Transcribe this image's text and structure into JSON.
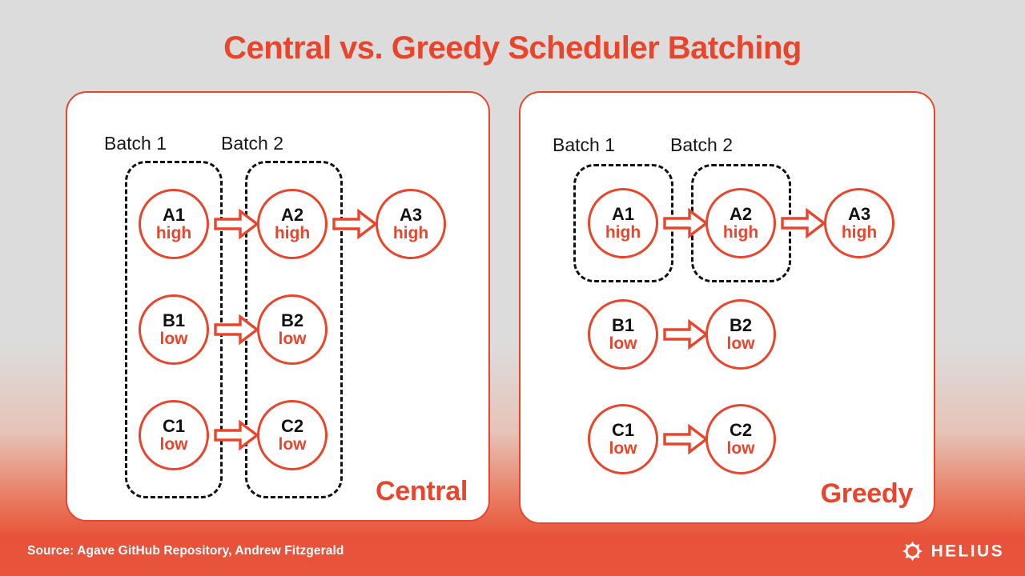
{
  "title": "Central vs. Greedy Scheduler Batching",
  "theme": {
    "accent": "#e8452c",
    "node_border": "#e8452c",
    "node_id_color": "#111214",
    "priority_color": "#e8452c",
    "batch_box_color": "#111111",
    "background_top": "#dcdcdc",
    "background_bottom": "#e8543c",
    "footer_text_color": "#ffffff"
  },
  "panels": [
    {
      "key": "central",
      "label": "Central",
      "batches": [
        {
          "label": "Batch 1"
        },
        {
          "label": "Batch 2"
        }
      ],
      "nodes": [
        {
          "id": "A1",
          "priority": "high"
        },
        {
          "id": "A2",
          "priority": "high"
        },
        {
          "id": "A3",
          "priority": "high"
        },
        {
          "id": "B1",
          "priority": "low"
        },
        {
          "id": "B2",
          "priority": "low"
        },
        {
          "id": "C1",
          "priority": "low"
        },
        {
          "id": "C2",
          "priority": "low"
        }
      ]
    },
    {
      "key": "greedy",
      "label": "Greedy",
      "batches": [
        {
          "label": "Batch 1"
        },
        {
          "label": "Batch 2"
        }
      ],
      "nodes": [
        {
          "id": "A1",
          "priority": "high"
        },
        {
          "id": "A2",
          "priority": "high"
        },
        {
          "id": "A3",
          "priority": "high"
        },
        {
          "id": "B1",
          "priority": "low"
        },
        {
          "id": "B2",
          "priority": "low"
        },
        {
          "id": "C1",
          "priority": "low"
        },
        {
          "id": "C2",
          "priority": "low"
        }
      ]
    }
  ],
  "footer": {
    "source": "Source: Agave GitHub Repository, Andrew Fitzgerald",
    "brand": "HELIUS",
    "logo_icon": "sunburst-icon"
  }
}
